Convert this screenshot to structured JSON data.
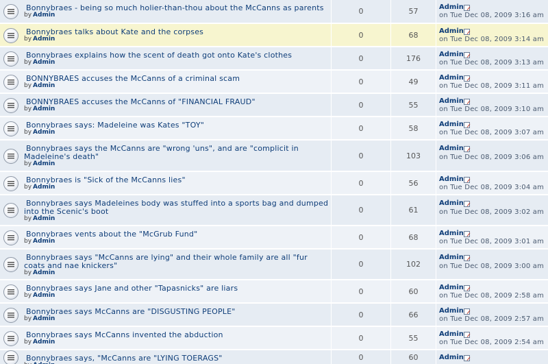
{
  "topics": [
    {
      "title": "Bonnybraes - being so much holier-than-thou about the McCanns as parents",
      "by": "by",
      "author": "Admin",
      "replies": "0",
      "views": "57",
      "last_author": "Admin",
      "last_date": "on Tue Dec 08, 2009 3:16 am"
    },
    {
      "title": "Bonnybraes talks about Kate and the corpses",
      "by": "by",
      "author": "Admin",
      "replies": "0",
      "views": "68",
      "last_author": "Admin",
      "last_date": "on Tue Dec 08, 2009 3:14 am"
    },
    {
      "title": "Bonnybraes explains how the scent of death got onto Kate's clothes",
      "by": "by",
      "author": "Admin",
      "replies": "0",
      "views": "176",
      "last_author": "Admin",
      "last_date": "on Tue Dec 08, 2009 3:13 am"
    },
    {
      "title": "BONNYBRAES accuses the McCanns of a criminal scam",
      "by": "by",
      "author": "Admin",
      "replies": "0",
      "views": "49",
      "last_author": "Admin",
      "last_date": "on Tue Dec 08, 2009 3:11 am"
    },
    {
      "title": "BONNYBRAES accuses the McCanns of \"FINANCIAL FRAUD\"",
      "by": "by",
      "author": "Admin",
      "replies": "0",
      "views": "55",
      "last_author": "Admin",
      "last_date": "on Tue Dec 08, 2009 3:10 am"
    },
    {
      "title": "Bonnybraes says: Madeleine was Kates \"TOY\"",
      "by": "by",
      "author": "Admin",
      "replies": "0",
      "views": "58",
      "last_author": "Admin",
      "last_date": "on Tue Dec 08, 2009 3:07 am"
    },
    {
      "title": "Bonnybraes says the McCanns are \"wrong 'uns\", and are \"complicit in Madeleine's death\"",
      "by": "by",
      "author": "Admin",
      "replies": "0",
      "views": "103",
      "last_author": "Admin",
      "last_date": "on Tue Dec 08, 2009 3:06 am"
    },
    {
      "title": "Bonnybraes is \"Sick of the McCanns lies\"",
      "by": "by",
      "author": "Admin",
      "replies": "0",
      "views": "56",
      "last_author": "Admin",
      "last_date": "on Tue Dec 08, 2009 3:04 am"
    },
    {
      "title": "Bonnybraes says Madeleines body was stuffed into a sports bag and dumped into the Scenic's boot",
      "by": "by",
      "author": "Admin",
      "replies": "0",
      "views": "61",
      "last_author": "Admin",
      "last_date": "on Tue Dec 08, 2009 3:02 am"
    },
    {
      "title": "Bonnybraes vents about the \"McGrub Fund\"",
      "by": "by",
      "author": "Admin",
      "replies": "0",
      "views": "68",
      "last_author": "Admin",
      "last_date": "on Tue Dec 08, 2009 3:01 am"
    },
    {
      "title": "Bonnybraes says \"McCanns are lying\" and their whole family are all \"fur coats and nae knickers\"",
      "by": "by",
      "author": "Admin",
      "replies": "0",
      "views": "102",
      "last_author": "Admin",
      "last_date": "on Tue Dec 08, 2009 3:00 am"
    },
    {
      "title": "Bonnybraes says Jane and other \"Tapasnicks\" are liars",
      "by": "by",
      "author": "Admin",
      "replies": "0",
      "views": "60",
      "last_author": "Admin",
      "last_date": "on Tue Dec 08, 2009 2:58 am"
    },
    {
      "title": "Bonnybraes says McCanns are \"DISGUSTING PEOPLE\"",
      "by": "by",
      "author": "Admin",
      "replies": "0",
      "views": "66",
      "last_author": "Admin",
      "last_date": "on Tue Dec 08, 2009 2:57 am"
    },
    {
      "title": "Bonnybraes says McCanns invented the abduction",
      "by": "by",
      "author": "Admin",
      "replies": "0",
      "views": "55",
      "last_author": "Admin",
      "last_date": "on Tue Dec 08, 2009 2:54 am"
    },
    {
      "title": "Bonnybraes says, \"McCanns are \"LYING TOERAGS\"",
      "by": "by",
      "author": "Admin",
      "replies": "0",
      "views": "60",
      "last_author": "Admin",
      "last_date": ""
    }
  ],
  "icons": {
    "topic": "topic-read-icon",
    "goto_last": "goto-last-post-icon"
  },
  "colors": {
    "row_bg": "#e6ecf3",
    "row_alt_bg": "#eef2f7",
    "highlight_bg": "#f7f5cf",
    "link": "#0e3d78"
  }
}
